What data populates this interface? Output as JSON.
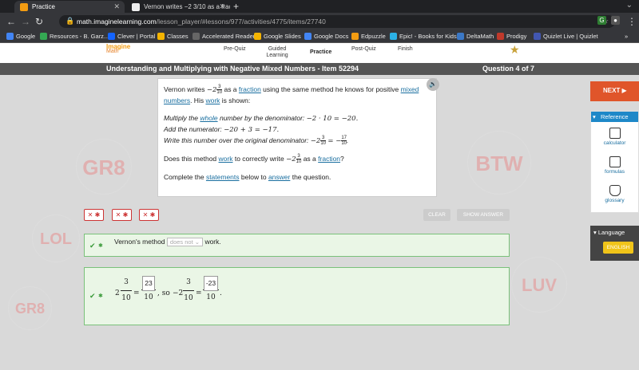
{
  "browser": {
    "tabs": [
      {
        "title": "Practice",
        "active": true
      },
      {
        "title": "Vernon writes −2 3/10 as a fract",
        "active": false
      }
    ],
    "new_tab": "+",
    "url_host": "math.imaginelearning.com",
    "url_path": "/lesson_player/#lessons/977/activities/4775/items/27740",
    "bookmarks": [
      {
        "label": "Google",
        "color": "#4285f4"
      },
      {
        "label": "Resources - B. Garz...",
        "color": "#34a853"
      },
      {
        "label": "Clever | Portal",
        "color": "#1464ff"
      },
      {
        "label": "Classes",
        "color": "#f4b400"
      },
      {
        "label": "Accelerated Reader",
        "color": "#666666"
      },
      {
        "label": "Google Slides",
        "color": "#f4b400"
      },
      {
        "label": "Google Docs",
        "color": "#4285f4"
      },
      {
        "label": "Edpuzzle",
        "color": "#f39c12"
      },
      {
        "label": "Epic! - Books for Kids",
        "color": "#2bb1e6"
      },
      {
        "label": "DeltaMath",
        "color": "#3b78c6"
      },
      {
        "label": "Prodigy",
        "color": "#c0392b"
      },
      {
        "label": "Quizlet Live | Quizlet",
        "color": "#4257b2"
      }
    ]
  },
  "app": {
    "logo_line1": "Imagine",
    "logo_line2": "Math",
    "nav": [
      "Pre-Quiz",
      "Guided Learning",
      "Practice",
      "Post-Quiz",
      "Finish"
    ],
    "title": "Understanding and Multiplying with Negative Mixed Numbers - Item 52294",
    "question_counter": "Question 4 of 7"
  },
  "question": {
    "p1_a": "Vernon writes",
    "p1_b": "as a",
    "p1_link1": "fraction",
    "p1_c": "using the same method he knows for positive",
    "p1_link2": "mixed numbers",
    "p1_d": ". His",
    "p1_link3": "work",
    "p1_e": "is shown:",
    "step1_a": "Multiply the",
    "step1_link": "whole",
    "step1_b": "number by the denominator:",
    "step1_math": "−2 · 10 = −20.",
    "step2_a": "Add the numerator:",
    "step2_math": "−20 + 3 = −17.",
    "step3_a": "Write this number over the original denominator:",
    "q_a": "Does this method",
    "q_link1": "work",
    "q_b": "to correctly write",
    "q_c": "as a",
    "q_link2": "fraction",
    "q_d": "?",
    "instr_a": "Complete the",
    "instr_link1": "statements",
    "instr_b": "below to",
    "instr_link2": "answer",
    "instr_c": "the question.",
    "mixed_whole": "−2",
    "mixed_num": "3",
    "mixed_den": "10",
    "result_num": "17",
    "result_den": "10",
    "result_sign": "= −"
  },
  "buttons": {
    "error_label": "✕",
    "clear": "CLEAR",
    "show_answer": "SHOW ANSWER",
    "next": "NEXT ▶"
  },
  "answer1": {
    "a": "Vernon's method",
    "dropdown_value": "does not",
    "b": "work."
  },
  "answer2": {
    "whole1": "2",
    "num1": "3",
    "den1": "10",
    "eq1": "=",
    "input1": "23",
    "den2": "10",
    "so": ", so",
    "whole2": "−2",
    "num3": "3",
    "den3": "10",
    "eq2": "=",
    "input2": "-23",
    "den4": "10",
    "period": "."
  },
  "reference": {
    "header": "Reference",
    "items": [
      "calculator",
      "formulas",
      "glossary"
    ]
  },
  "language": {
    "header": "Language",
    "button": "ENGLISH"
  },
  "background_words": [
    "GR8",
    "LOL",
    "BTW",
    "LUV",
    "GR8"
  ]
}
